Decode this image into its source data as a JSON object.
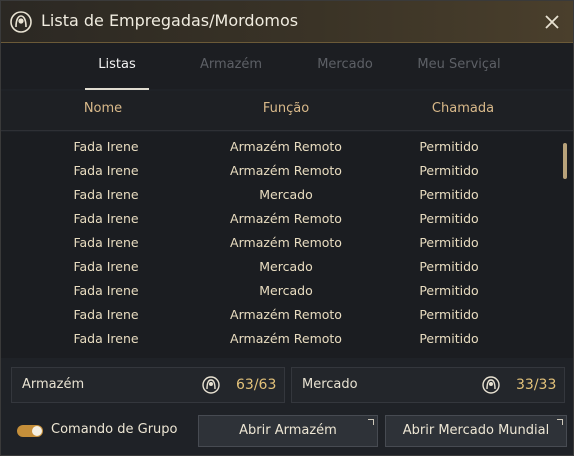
{
  "window": {
    "title": "Lista de Empregadas/Mordomos"
  },
  "tabs": [
    {
      "label": "Listas"
    },
    {
      "label": "Armazém"
    },
    {
      "label": "Mercado"
    },
    {
      "label": "Meu Serviçal"
    }
  ],
  "columns": {
    "name": "Nome",
    "role": "Função",
    "call": "Chamada"
  },
  "rows": [
    {
      "name": "Fada Irene",
      "role": "Armazém Remoto",
      "call": "Permitido"
    },
    {
      "name": "Fada Irene",
      "role": "Armazém Remoto",
      "call": "Permitido"
    },
    {
      "name": "Fada Irene",
      "role": "Mercado",
      "call": "Permitido"
    },
    {
      "name": "Fada Irene",
      "role": "Armazém Remoto",
      "call": "Permitido"
    },
    {
      "name": "Fada Irene",
      "role": "Armazém Remoto",
      "call": "Permitido"
    },
    {
      "name": "Fada Irene",
      "role": "Mercado",
      "call": "Permitido"
    },
    {
      "name": "Fada Irene",
      "role": "Mercado",
      "call": "Permitido"
    },
    {
      "name": "Fada Irene",
      "role": "Armazém Remoto",
      "call": "Permitido"
    },
    {
      "name": "Fada Irene",
      "role": "Armazém Remoto",
      "call": "Permitido"
    }
  ],
  "summary": {
    "storage": {
      "label": "Armazém",
      "count": "63/63"
    },
    "market": {
      "label": "Mercado",
      "count": "33/33"
    }
  },
  "footer": {
    "group_command_label": "Comando de Grupo",
    "group_command_on": true,
    "open_storage_label": "Abrir Armazém",
    "open_world_market_label": "Abrir Mercado Mundial"
  },
  "colors": {
    "accent": "#e3c27a",
    "header_text": "#d9b98a",
    "toggle": "#c58f3a"
  },
  "icons": {
    "title": "maid-silhouette-icon",
    "close": "close-icon",
    "count": "maid-silhouette-icon"
  }
}
